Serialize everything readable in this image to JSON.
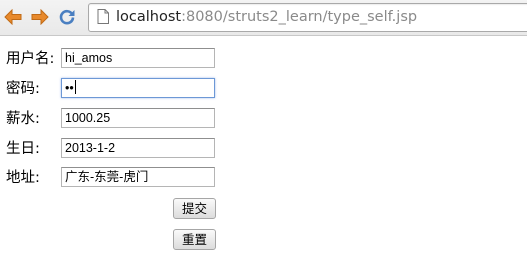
{
  "browser": {
    "url_host": "localhost",
    "url_path": ":8080/struts2_learn/type_self.jsp",
    "icons": {
      "back": "back-arrow-icon",
      "forward": "forward-arrow-icon",
      "reload": "reload-icon",
      "page": "page-icon"
    },
    "colors": {
      "nav_arrow": "#e8892b",
      "reload": "#4a7fc1"
    }
  },
  "form": {
    "fields": [
      {
        "label": "用户名:",
        "value": "hi_amos"
      },
      {
        "label": "密码:",
        "value": "••"
      },
      {
        "label": "薪水:",
        "value": "1000.25"
      },
      {
        "label": "生日:",
        "value": "2013-1-2"
      },
      {
        "label": "地址:",
        "value": "广东-东莞-虎门"
      }
    ],
    "submit_label": "提交",
    "reset_label": "重置"
  }
}
